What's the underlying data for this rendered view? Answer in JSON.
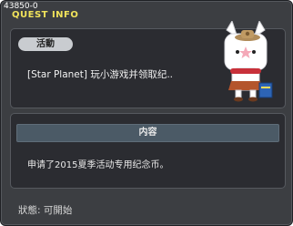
{
  "window": {
    "quest_id": "43850-0",
    "title": "QUEST INFO"
  },
  "quest": {
    "category_tag": "活動",
    "title": "[Star Planet] 玩小游戏并领取纪.."
  },
  "content": {
    "header": "内容",
    "description": "申请了2015夏季活动专用纪念币。"
  },
  "status": {
    "text": "狀態: 可開始"
  },
  "npc": {
    "icon": "white-bunny-npc-icon"
  },
  "colors": {
    "title_accent": "#f1e35b",
    "window_bg": "#3c3e42",
    "panel_bg": "#2b2c31",
    "header_bg": "#4b5a66"
  }
}
